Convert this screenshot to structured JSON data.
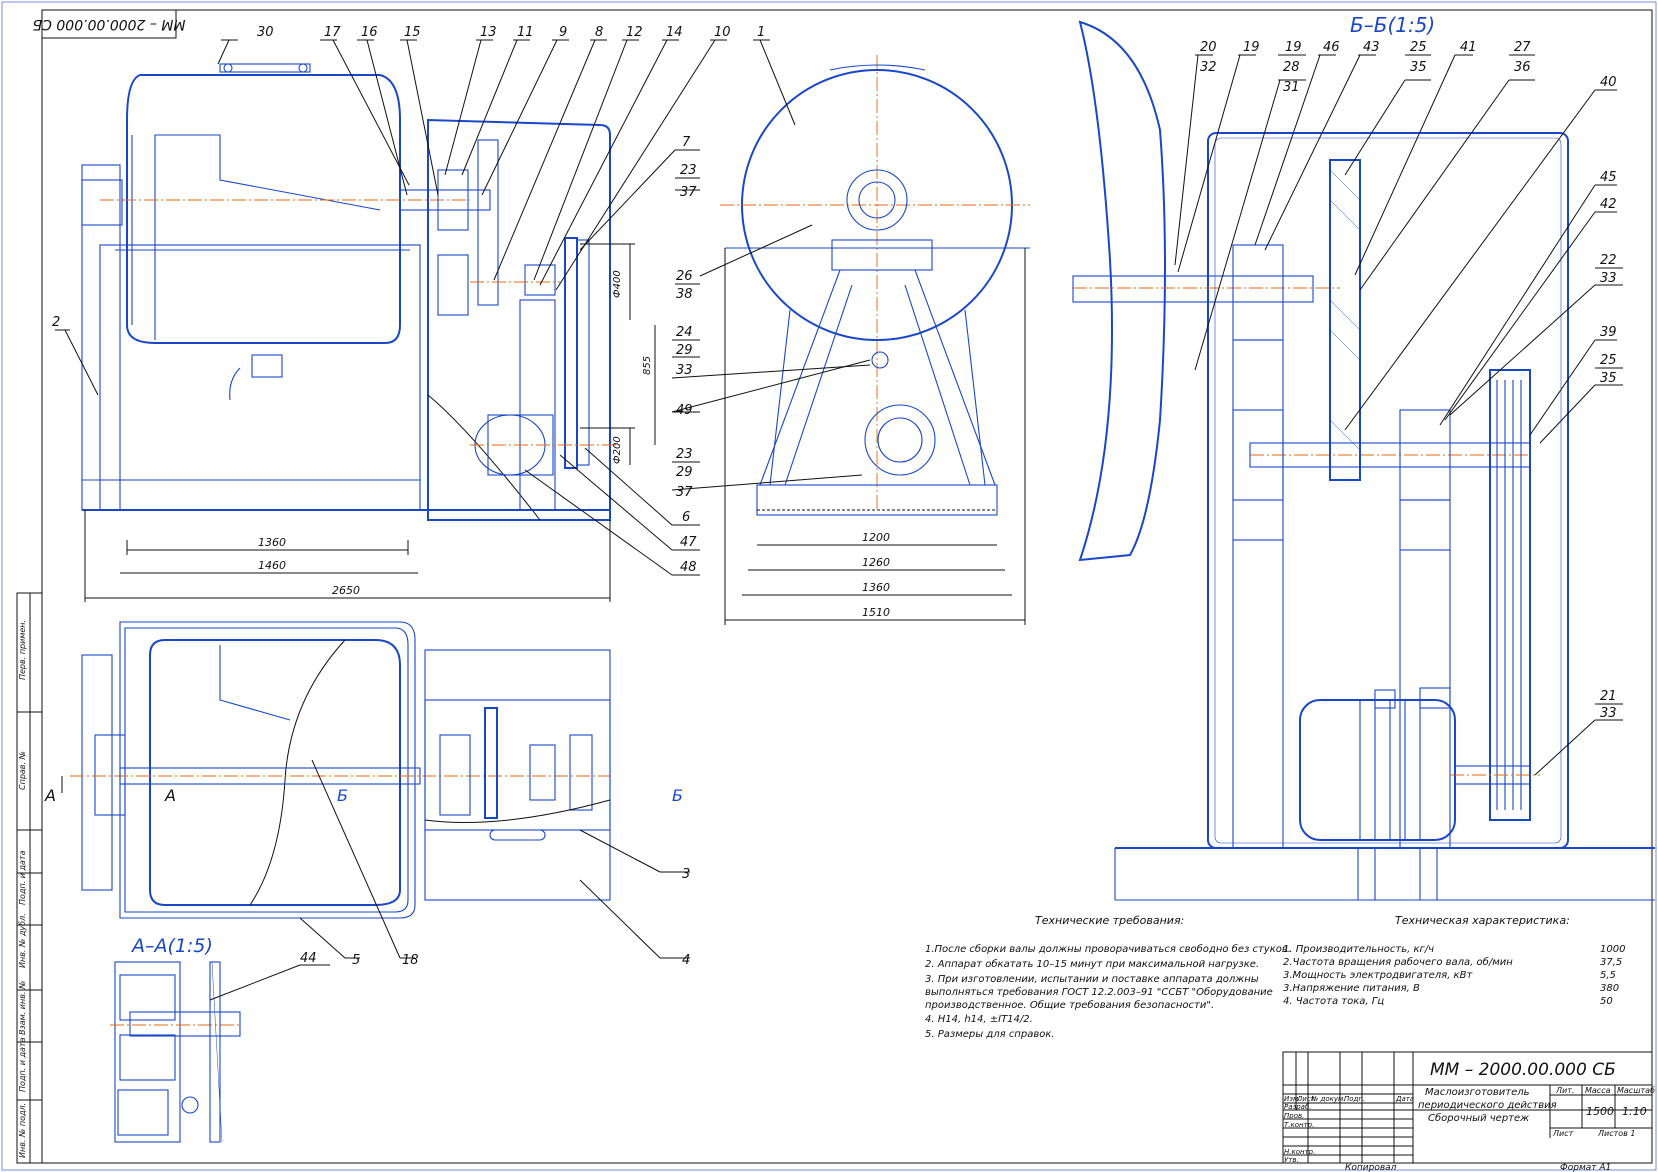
{
  "designation": "ММ – 2000.00.000 СБ",
  "designation_inverted": "ММ – 2000.00.000 СБ",
  "product_name": [
    "Маслоизготовитель",
    "периодического действия",
    "Сборочный чертеж"
  ],
  "mass": "1500",
  "scale": "1:10",
  "copied": "Копировал",
  "format": "Формат   А1",
  "sheet_label": "Лист",
  "sheets_label": "Листов   1",
  "title_headers": [
    "Лит.",
    "Масса",
    "Масштаб"
  ],
  "change_headers": [
    "Изм.",
    "Лист",
    "№ докум.",
    "Подп.",
    "Дата"
  ],
  "roles": [
    "Разраб.",
    "Пров.",
    "Т.контр.",
    "",
    "Н.контр.",
    "Утв."
  ],
  "side_stamp": [
    "Перв. примен.",
    "Справ. №",
    "Подп. и дата",
    "Инв. № дубл.",
    "Взам. инв. №",
    "Подп. и дата",
    "Инв. № подл."
  ],
  "views": {
    "section_bb": "Б–Б(1:5)",
    "section_aa": "А–А(1:5)",
    "cut_a": "А",
    "cut_b": "Б"
  },
  "dimensions": {
    "d1360a": "1360",
    "d1460": "1460",
    "d2650": "2650",
    "d1200": "1200",
    "d1260": "1260",
    "d1360b": "1360",
    "d1510": "1510",
    "d400": "Ф400",
    "d855": "855",
    "d200": "Ф200"
  },
  "callouts_top": [
    "30",
    "17",
    "16",
    "15",
    "13",
    "11",
    "9",
    "8",
    "12",
    "14",
    "10",
    "1"
  ],
  "callouts_right": {
    "c7": "7",
    "c23a": "23",
    "c37a": "37",
    "c26": "26",
    "c38": "38",
    "c24": "24",
    "c29a": "29",
    "c33a": "33",
    "c49": "49",
    "c23b": "23",
    "c29b": "29",
    "c37b": "37",
    "c6": "6",
    "c47": "47",
    "c48": "48",
    "c2": "2"
  },
  "callouts_plan": {
    "c3": "3",
    "c4": "4",
    "c5": "5",
    "c18": "18",
    "c44": "44"
  },
  "callouts_bb": {
    "c20": "20",
    "c32": "32",
    "c19a": "19",
    "c19b": "19",
    "c28": "28",
    "c31": "31",
    "c46": "46",
    "c43": "43",
    "c25a": "25",
    "c35a": "35",
    "c41": "41",
    "c27": "27",
    "c36": "36",
    "c40": "40",
    "c45": "45",
    "c42": "42",
    "c22": "22",
    "c33b": "33",
    "c39": "39",
    "c25b": "25",
    "c35b": "35",
    "c21": "21",
    "c33c": "33"
  },
  "requirements": {
    "title": "Технические требования:",
    "lines": [
      "1.После сборки валы должны проворачиваться свободно без стуков.",
      "2. Аппарат обкатать 10–15 минут при максимальной нагрузке.",
      "3. При изготовлении, испытании и поставке аппарата должны",
      "выполняться требования ГОСТ 12.2.003–91 \"ССБТ \"Оборудование",
      "производственное. Общие требования безопасности\".",
      "4. Н14, h14, ±IT14/2.",
      "5. Размеры для справок."
    ]
  },
  "characteristics": {
    "title": "Техническая характеристика:",
    "rows": [
      {
        "label": "1. Производительность, кг/ч",
        "value": "1000"
      },
      {
        "label": "2.Частота вращения рабочего вала, об/мин",
        "value": "37,5"
      },
      {
        "label": "3.Мощность электродвигателя, кВт",
        "value": "5,5"
      },
      {
        "label": "3.Напряжение питания, В",
        "value": "380"
      },
      {
        "label": "4. Частота тока, Гц",
        "value": "50"
      }
    ]
  }
}
